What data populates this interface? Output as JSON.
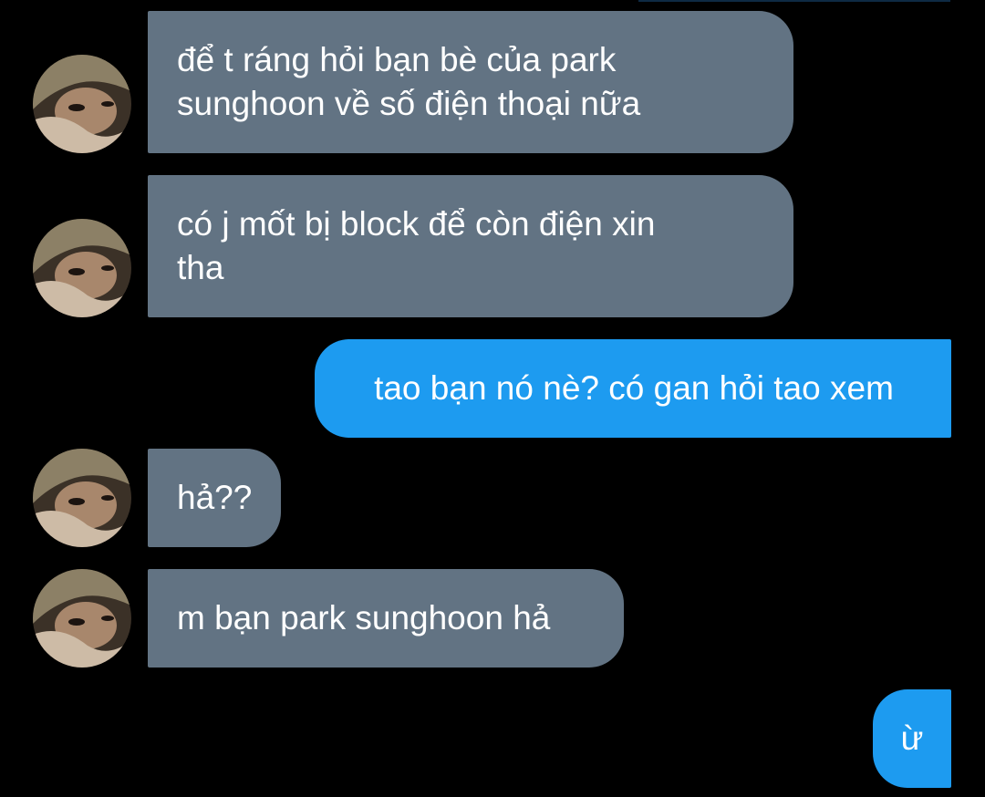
{
  "colors": {
    "background": "#000000",
    "incoming_bubble": "#627383",
    "outgoing_bubble": "#1d9bf0",
    "text": "#ffffff"
  },
  "conversation": {
    "messages": [
      {
        "direction": "incoming",
        "avatar": "contact-avatar-photo",
        "text": "để t ráng hỏi bạn bè của park\nsunghoon về số điện thoại nữa"
      },
      {
        "direction": "incoming",
        "avatar": "contact-avatar-photo",
        "text": "có j mốt bị block để còn điện xin\ntha"
      },
      {
        "direction": "outgoing",
        "text": "tao bạn nó nè? có gan hỏi tao xem"
      },
      {
        "direction": "incoming",
        "avatar": "contact-avatar-photo",
        "text": "hả??"
      },
      {
        "direction": "incoming",
        "avatar": "contact-avatar-photo",
        "text": "m bạn park sunghoon hả"
      },
      {
        "direction": "outgoing",
        "text": "ừ"
      }
    ]
  }
}
